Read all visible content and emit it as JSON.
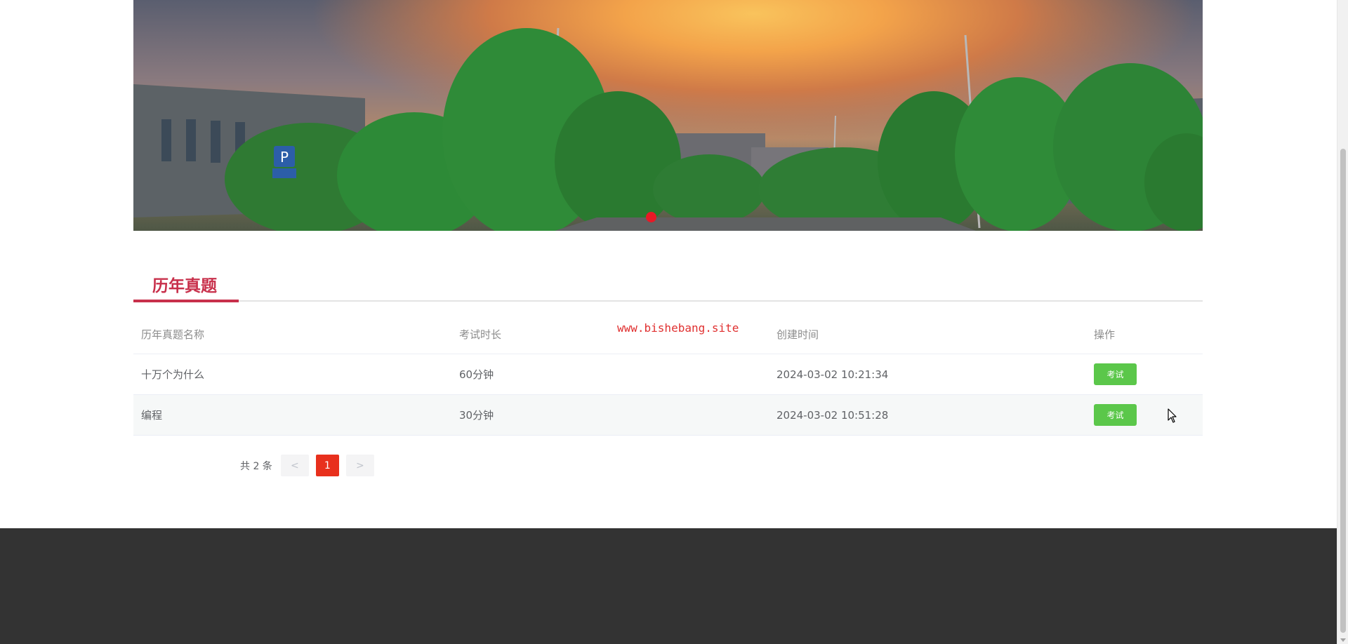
{
  "banner": {
    "image_alt": "campus street with trees at sunset",
    "dot_color": "#e81926"
  },
  "section": {
    "title": "历年真题",
    "accent_color": "#c8304b"
  },
  "watermark": "www.bishebang.site",
  "table": {
    "headers": [
      "历年真题名称",
      "考试时长",
      "创建时间",
      "操作"
    ],
    "rows": [
      {
        "name": "十万个为什么",
        "duration": "60分钟",
        "created": "2024-03-02 10:21:34",
        "action": "考试"
      },
      {
        "name": "编程",
        "duration": "30分钟",
        "created": "2024-03-02 10:51:28",
        "action": "考试"
      }
    ]
  },
  "pagination": {
    "total": "共 2 条",
    "prev": "<",
    "current": "1",
    "next": ">"
  },
  "colors": {
    "button_green": "#5bc74a",
    "pager_active": "#e8301d",
    "footer": "#333333"
  }
}
